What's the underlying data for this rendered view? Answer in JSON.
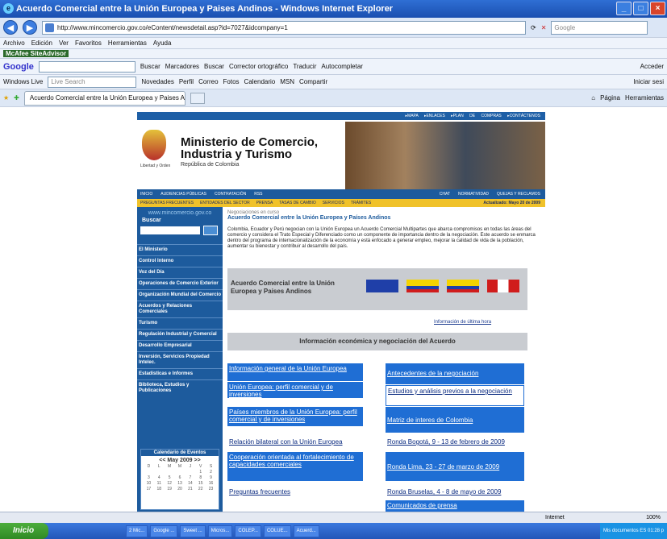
{
  "window": {
    "title": "Acuerdo Comercial entre la Unión Europea y Paises Andinos - Windows Internet Explorer"
  },
  "address": {
    "url": "http://www.mincomercio.gov.co/eContent/newsdetail.asp?id=7027&idcompany=1",
    "search_placeholder": "Google"
  },
  "menu": [
    "Archivo",
    "Edición",
    "Ver",
    "Favoritos",
    "Herramientas",
    "Ayuda"
  ],
  "mcafee": "McAfee SiteAdvisor",
  "googlebar": {
    "logo": "Google",
    "buscar": "Buscar",
    "marcadores": "Marcadores",
    "buscar2": "Buscar",
    "corrector": "Corrector ortográfico",
    "traducir": "Traducir",
    "autocompletar": "Autocompletar",
    "acceder": "Acceder"
  },
  "wlbar": {
    "label": "Windows Live",
    "search": "Live Search",
    "items": [
      "Novedades",
      "Perfil",
      "Correo",
      "Fotos",
      "Calendario",
      "MSN",
      "Compartir"
    ],
    "iniciar": "Iniciar sesi"
  },
  "tab": {
    "label": "Acuerdo Comercial entre la Unión Europea y Paises A...",
    "pagina": "Página",
    "herramientas": "Herramientas"
  },
  "site": {
    "toplinks": "▸MAPA ▸ENLACES ▸PLAN DE COMPRAS ▸CONTÁCTENOS",
    "ministerio": "Ministerio de Comercio, Industria y Turismo",
    "republica": "República de Colombia",
    "libertad": "Libertad y Orden",
    "nav1": [
      "INICIO",
      "AUDIENCIAS PÚBLICAS",
      "CONTRATACIÓN",
      "RSS",
      "CHAT",
      "NORMATIVIDAD",
      "QUEJAS Y RECLAMOS"
    ],
    "nav2": [
      "PREGUNTAS FRECUENTES",
      "ENTIDADES DEL SECTOR",
      "PRENSA",
      "TASAS DE CAMBIO",
      "SERVICIOS",
      "TRÁMITES"
    ],
    "updated": "Actualizado: Mayo 20 de 2009",
    "siteurl": "www.mincomercio.gov.co",
    "buscar": "Buscar",
    "sidebar": [
      "El Ministerio",
      "Control Interno",
      "Voz del Día",
      "Operaciones de Comercio Exterior",
      "Organización Mundial del Comercio",
      "Acuerdos y Relaciones Comerciales",
      "Turismo",
      "Regulación Industrial y Comercial",
      "Desarrollo Empresarial",
      "Inversión, Servicios Propiedad Intelec.",
      "Estadísticas e Informes",
      "Biblioteca, Estudios y Publicaciones"
    ],
    "calendar": {
      "title": "Calendario de Eventos",
      "month": "May 2009",
      "days": [
        "D",
        "L",
        "M",
        "M",
        "J",
        "V",
        "S",
        "",
        "",
        "",
        "",
        "",
        "1",
        "2",
        "3",
        "4",
        "5",
        "6",
        "7",
        "8",
        "9",
        "10",
        "11",
        "12",
        "13",
        "14",
        "15",
        "16",
        "17",
        "18",
        "19",
        "20",
        "21",
        "22",
        "23"
      ]
    },
    "crumb": "Negociaciones en curso",
    "heading": "Acuerdo Comercial entre la Unión Europea y Países Andinos",
    "para": "Colombia, Ecuador y Perú negocian con la Unión Europea un Acuerdo Comercial Multipartes que abarca compromisos en todas las áreas del comercio y considera el Trato Especial y Diferenciado como un componente de importancia dentro de la negociación. Este acuerdo se enmarca dentro del programa de internacionalización de la economía y está enfocado a generar empleo, mejorar la calidad de vida de la población, aumentar su bienestar y contribuir al desarrollo del país.",
    "banner": "Acuerdo Comercial entre la Unión Europea y Paises Andinos",
    "ultima": "Información de última hora",
    "infobar": "Información económica y negociación del Acuerdo",
    "links_left": [
      "Información general de la Unión Europea",
      "Unión Europea: perfil comercial y de inversiones",
      "Países miembros de la Unión Europea: perfil comercial y de inversiones",
      "Relación bilateral con la Unión Europea",
      "Cooperación orientada al fortalecimiento de capacidades comerciales",
      "Preguntas frecuentes"
    ],
    "links_right": [
      "Antecedentes de la negociación",
      "Estudios y análisis previos a la negociación",
      "Matriz de interes de Colombia",
      "Ronda Bogotá, 9 - 13 de febrero de 2009",
      "Ronda Lima, 23 - 27 de marzo de 2009",
      "Ronda Bruselas, 4 - 8 de mayo de 2009",
      "Comunicados de prensa"
    ]
  },
  "status": {
    "zone": "Internet",
    "zoom": "100%"
  },
  "taskbar": {
    "start": "Inicio",
    "tasks": [
      "2 Mic...",
      "Google ...",
      "Sweet ...",
      "Micros...",
      "COLEP...",
      "COLUE...",
      "Acuerd..."
    ],
    "tray": "Mis documentos  ES  01:28 p"
  }
}
